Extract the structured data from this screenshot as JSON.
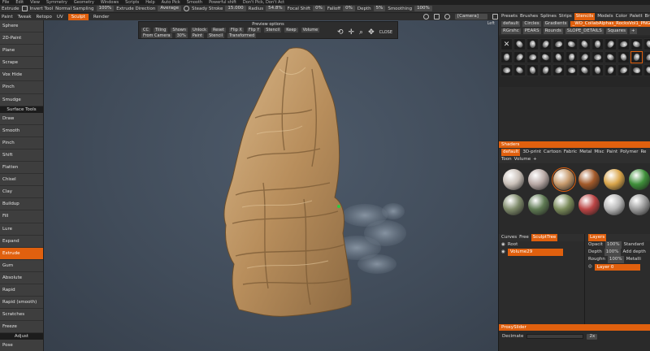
{
  "menu": [
    "File",
    "Edit",
    "View",
    "Symmetry",
    "Geometry",
    "Windows",
    "Scripts",
    "Help",
    "Auto Pick",
    "Smooth",
    "Powerful shift",
    "Don't Pick, Don't Act"
  ],
  "toolbar1": {
    "mode_label": "Extrude",
    "invert_tool": "Invert Tool",
    "normal_sampling_label": "Normal Sampling",
    "normal_sampling_value": "100%",
    "extrude_direction_label": "Extrude Direction",
    "extrude_direction_value": "Average",
    "steady_stroke_label": "Steady Stroke",
    "steady_stroke_value": "15.000",
    "radius_label": "Radius",
    "radius_value": "54.8%",
    "focal_shift_label": "Focal Shift",
    "focal_shift_value": "0%",
    "falloff_label": "Falloff",
    "falloff_value": "0%",
    "depth_label": "Depth",
    "depth_value": "5%",
    "smoothing_label": "Smoothing",
    "smoothing_value": "100%"
  },
  "toolbar2": {
    "items": [
      "Paint",
      "Tweak",
      "Retopo",
      "UV",
      "Sculpt",
      "Render"
    ],
    "active": "Sculpt",
    "camera": "[Camera]"
  },
  "left_tools_top": [
    "Sphere",
    "2D-Paint",
    "Plane",
    "Scrape",
    "Vox Hide",
    "Pinch",
    "Smudge"
  ],
  "surface_tools_label": "Surface Tools",
  "left_tools": [
    "Draw",
    "Smooth",
    "Pinch",
    "Shift",
    "Flatten",
    "Chisel",
    "Clay",
    "Buildup",
    "Fill",
    "Lure",
    "Expand",
    "Extrude",
    "Gum",
    "Absolute",
    "Rapid",
    "Rapid (smooth)",
    "Scratches",
    "Freeze"
  ],
  "active_tool": "Extrude",
  "adjust_label": "Adjust",
  "adjust_tool": "Pose",
  "viewport": {
    "view_label": "Left"
  },
  "preview": {
    "title": "Preview options",
    "row1": [
      "CC",
      "Tiling",
      "Shown",
      "Unlock",
      "Reset",
      "Flip X",
      "Flip Y",
      "Stencil",
      "Keep",
      "Volume"
    ],
    "row2": [
      "From Camera",
      "30%",
      "Paint",
      "Stencil",
      "Transformed"
    ],
    "close": "CLOSE"
  },
  "right_tabs": [
    "Presets",
    "Brushes",
    "Splines",
    "Strips",
    "Stencils",
    "Models",
    "Color",
    "Palett",
    "Bru"
  ],
  "right_tabs_active": "Stencils",
  "stencil_chips_row1": [
    "default",
    "Circles",
    "Gradients",
    "_WO_CollabAlphas_RocksVol1_PNG"
  ],
  "stencil_chips_row2": [
    "RGrshc",
    "PEARS",
    "Rounds",
    "SLOPE_DETAILS",
    "Squares",
    "+"
  ],
  "stencil_count": 36,
  "stencil_selected_index": 22,
  "shaders_label": "Shaders",
  "shader_tabs_row1": [
    "default",
    "3D-print",
    "Cartoon",
    "Fabric",
    "Metal",
    "Misc",
    "Paint",
    "Polymer",
    "Re"
  ],
  "shader_tabs_row2": [
    "Toon",
    "Volume",
    "+"
  ],
  "shader_colors": [
    "#c9c0b8",
    "#b8a9a5",
    "#c79a6c",
    "#a35a2a",
    "#d9a54a",
    "#3f8f3a",
    "#7e8a6a",
    "#5f7a53",
    "#7a8a5a",
    "#b44",
    "#b7b7b7",
    "#9a9a9a"
  ],
  "shader_selected_index": 2,
  "sculpt_tabs": [
    "Curves",
    "Free",
    "SculptTree"
  ],
  "sculpt_tabs_active": "SculptTree",
  "tree_root": "Root",
  "tree_volume": "Volume29",
  "layers_label": "Layers",
  "layers_rows": [
    {
      "label": "Opacit",
      "value": "100%",
      "mode": "Standard"
    },
    {
      "label": "Depth",
      "value": "100%",
      "mode": "Add depth"
    },
    {
      "label": "Roughn",
      "value": "100%",
      "mode": "Metalli"
    }
  ],
  "layer_name": "Layer 0",
  "proxy_label": "ProxySlider",
  "decimate_label": "Decimate",
  "decimate_value": "2x"
}
